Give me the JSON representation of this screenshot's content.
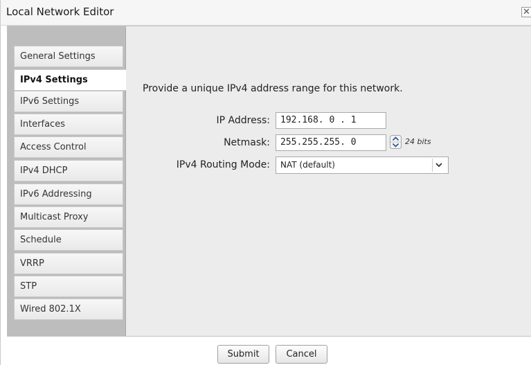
{
  "window": {
    "title": "Local Network Editor",
    "close_glyph": "✕"
  },
  "sidebar": {
    "active_index": 1,
    "items": [
      {
        "label": "General Settings"
      },
      {
        "label": "IPv4 Settings"
      },
      {
        "label": "IPv6 Settings"
      },
      {
        "label": "Interfaces"
      },
      {
        "label": "Access Control"
      },
      {
        "label": "IPv4 DHCP"
      },
      {
        "label": "IPv6 Addressing"
      },
      {
        "label": "Multicast Proxy"
      },
      {
        "label": "Schedule"
      },
      {
        "label": "VRRP"
      },
      {
        "label": "STP"
      },
      {
        "label": "Wired 802.1X"
      }
    ]
  },
  "main": {
    "intro": "Provide a unique IPv4 address range for this network.",
    "ip_address": {
      "label": "IP Address:",
      "value": "192.168.  0 .  1"
    },
    "netmask": {
      "label": "Netmask:",
      "value": "255.255.255.  0",
      "bits": "24 bits"
    },
    "routing_mode": {
      "label": "IPv4 Routing Mode:",
      "value": "NAT (default)"
    }
  },
  "footer": {
    "submit_label": "Submit",
    "cancel_label": "Cancel"
  },
  "icons": {
    "close": "close-icon",
    "spinner_up": "chevron-up-icon",
    "spinner_down": "chevron-down-icon",
    "select": "chevron-down-icon"
  }
}
